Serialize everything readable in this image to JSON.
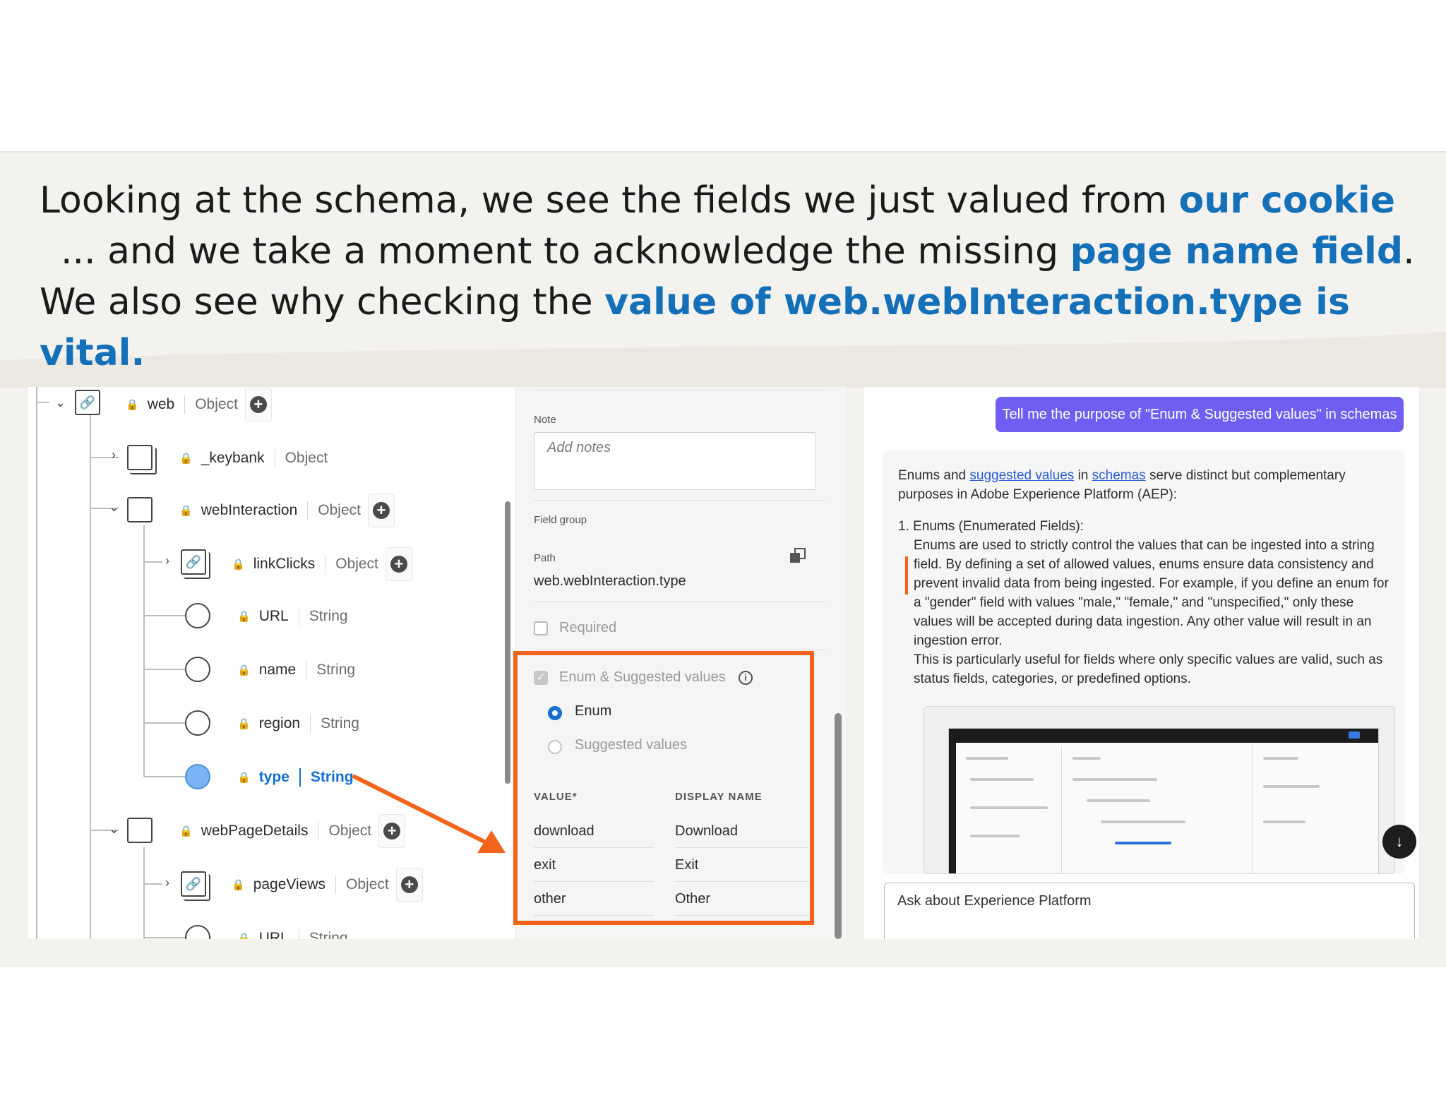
{
  "caption": {
    "line1_prefix": "Looking at the schema, we see the fields we just valued from ",
    "line1_hl": "our cookie",
    "line2_prefix": "... and we take a moment to acknowledge the missing ",
    "line2_hl": "page name field",
    "line2_suffix": ".",
    "line3_prefix": "We also see why checking the ",
    "line3_hl": "value of web.webInteraction.type is vital."
  },
  "tree": {
    "rows": [
      {
        "name": "web",
        "type": "Object"
      },
      {
        "name": "_keybank",
        "type": "Object"
      },
      {
        "name": "webInteraction",
        "type": "Object"
      },
      {
        "name": "linkClicks",
        "type": "Object"
      },
      {
        "name": "URL",
        "type": "String"
      },
      {
        "name": "name",
        "type": "String"
      },
      {
        "name": "region",
        "type": "String"
      },
      {
        "name": "type",
        "type": "String"
      },
      {
        "name": "webPageDetails",
        "type": "Object"
      },
      {
        "name": "pageViews",
        "type": "Object"
      },
      {
        "name": "URL",
        "type": "String"
      }
    ]
  },
  "props": {
    "note_label": "Note",
    "note_placeholder": "Add notes",
    "field_group_label": "Field group",
    "path_label": "Path",
    "path_value": "web.webInteraction.type",
    "required_label": "Required",
    "enum_suggested_label": "Enum & Suggested values",
    "enum_label": "Enum",
    "suggested_label": "Suggested values",
    "col_value": "VALUE",
    "col_value_star": "*",
    "col_display": "DISPLAY NAME",
    "rows": [
      {
        "value": "download",
        "display": "Download"
      },
      {
        "value": "exit",
        "display": "Exit"
      },
      {
        "value": "other",
        "display": "Other"
      }
    ]
  },
  "assistant": {
    "prompt": "Tell me the purpose of \"Enum & Suggested values\" in schemas",
    "intro_a": "Enums and ",
    "intro_link1": "suggested values",
    "intro_b": " in ",
    "intro_link2": "schemas",
    "intro_c": " serve distinct but complementary purposes in Adobe Experience Platform (AEP):",
    "item1_title": "1. Enums (Enumerated Fields):",
    "item1_p1": "Enums are used to strictly control the values that can be ingested into a string field. By defining a set of allowed values, enums ensure data consistency and prevent invalid data from being ingested. For example, if you define an enum for a \"gender\" field with values \"male,\" \"female,\" and \"unspecified,\" only these values will be accepted during data ingestion. Any other value will result in an ingestion error.",
    "item1_p2": "This is particularly useful for fields where only specific values are valid, such as status fields, categories, or predefined options.",
    "ask_placeholder": "Ask about Experience Platform"
  },
  "colors": {
    "highlight": "#1470b8",
    "callout": "#f2641b",
    "assistant_bubble": "#6e5ff2",
    "selected": "#1570d0"
  }
}
